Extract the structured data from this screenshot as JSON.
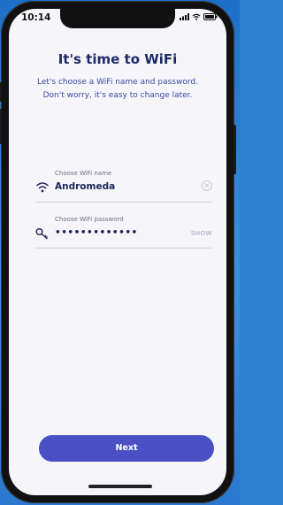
{
  "status": {
    "time": "10:14"
  },
  "header": {
    "title": "It's time to WiFi",
    "subtitle_line1": "Let's choose a WiFi name and password.",
    "subtitle_line2": "Don't worry, it's easy to change later."
  },
  "form": {
    "wifi_name": {
      "label": "Choose WiFi name",
      "value": "Andromeda",
      "icon": "wifi-icon"
    },
    "wifi_password": {
      "label": "Choose WiFi password",
      "value": "•••••••••••••",
      "icon": "key-icon",
      "show_label": "SHOW"
    }
  },
  "actions": {
    "next_label": "Next"
  },
  "colors": {
    "accent": "#4a4fc4",
    "title": "#1f2a66",
    "subtitle": "#3848a0",
    "background": "#f6f6fa"
  }
}
